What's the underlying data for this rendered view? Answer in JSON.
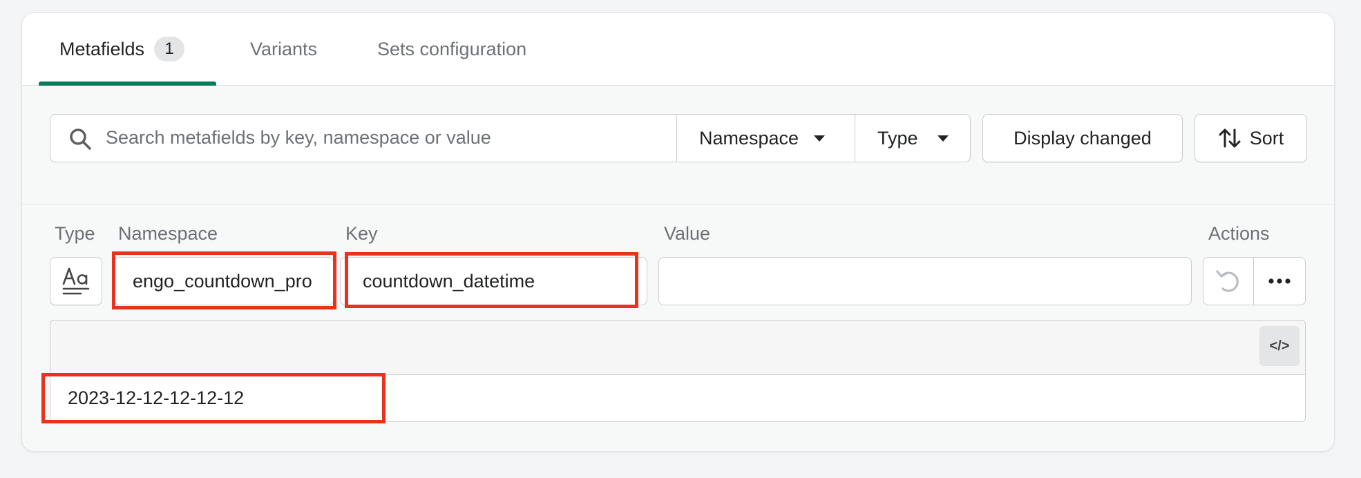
{
  "tabs": [
    {
      "label": "Metafields",
      "count": "1"
    },
    {
      "label": "Variants"
    },
    {
      "label": "Sets configuration"
    }
  ],
  "filters": {
    "search_placeholder": "Search metafields by key, namespace or value",
    "namespace_label": "Namespace",
    "type_label": "Type",
    "display_changed_label": "Display changed",
    "sort_label": "Sort"
  },
  "columns": {
    "type": "Type",
    "namespace": "Namespace",
    "key": "Key",
    "value": "Value",
    "actions": "Actions"
  },
  "row": {
    "type_icon": "text-type-icon",
    "namespace": "engo_countdown_pro",
    "key": "countdown_datetime",
    "value": "",
    "editor_value": "2023-12-12-12-12-12",
    "code_toggle": "</>"
  },
  "colors": {
    "accent": "#0c7a5a",
    "highlight": "#e8321e"
  }
}
